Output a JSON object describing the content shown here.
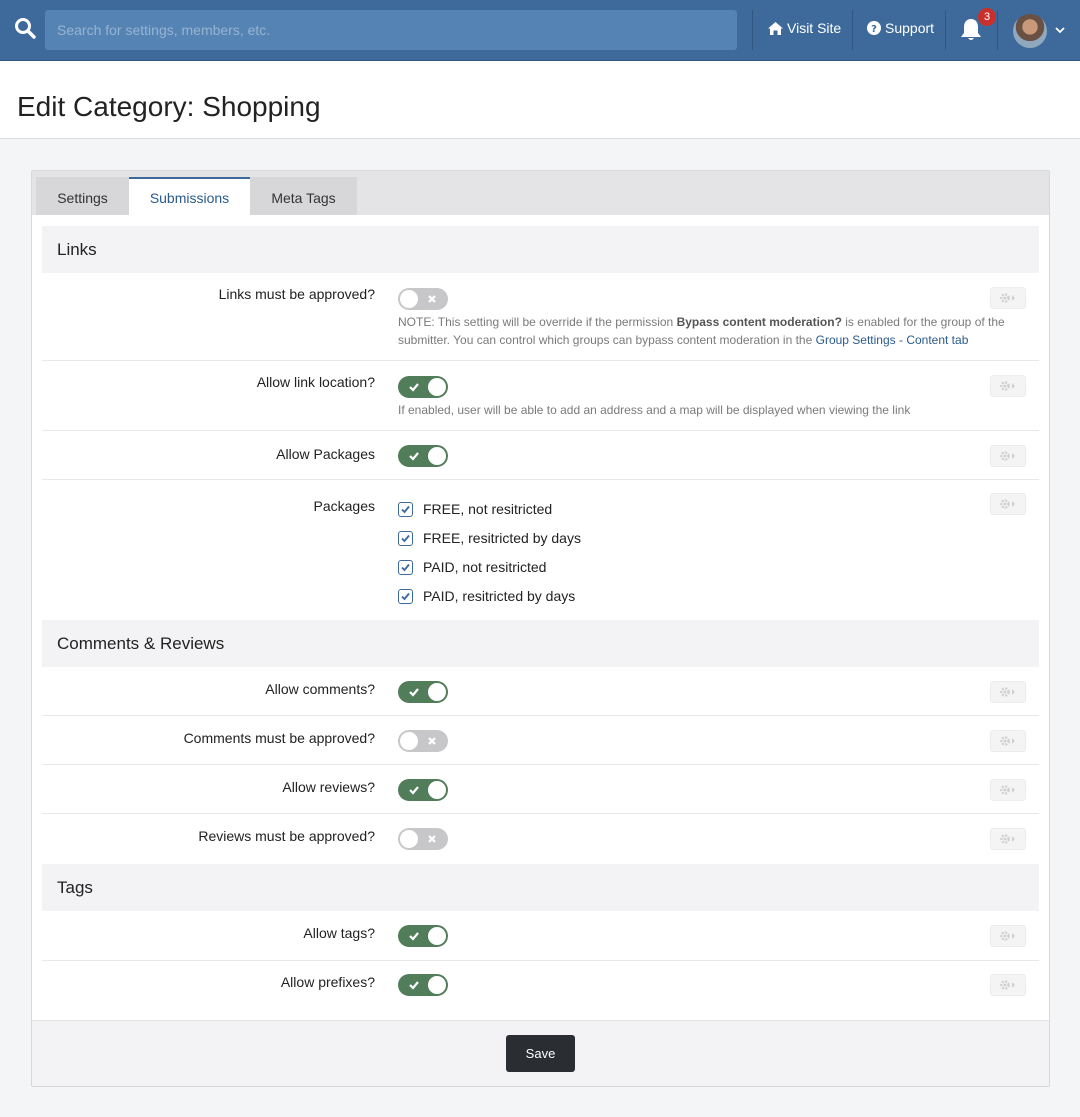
{
  "topbar": {
    "search_placeholder": "Search for settings, members, etc.",
    "visit_site": "Visit Site",
    "support": "Support",
    "notification_count": "3"
  },
  "page": {
    "title": "Edit Category: Shopping"
  },
  "tabs": [
    {
      "label": "Settings",
      "active": false
    },
    {
      "label": "Submissions",
      "active": true
    },
    {
      "label": "Meta Tags",
      "active": false
    }
  ],
  "sections": {
    "links": {
      "title": "Links",
      "links_approved": {
        "label": "Links must be approved?",
        "enabled": false,
        "help_prefix": "NOTE: This setting will be override if the permission",
        "help_bold": "Bypass content moderation?",
        "help_mid": "is enabled for the group of the submitter. You can control which groups can bypass content moderation in the",
        "help_link": "Group Settings - Content tab"
      },
      "link_location": {
        "label": "Allow link location?",
        "enabled": true,
        "help": "If enabled, user will be able to add an address and a map will be displayed when viewing the link"
      },
      "packages_toggle": {
        "label": "Allow Packages",
        "enabled": true
      },
      "packages": {
        "label": "Packages",
        "options": [
          {
            "label": "FREE, not resitricted",
            "checked": true
          },
          {
            "label": "FREE, resitricted by days",
            "checked": true
          },
          {
            "label": "PAID, not resitricted",
            "checked": true
          },
          {
            "label": "PAID, resitricted by days",
            "checked": true
          }
        ]
      }
    },
    "comments": {
      "title": "Comments & Reviews",
      "allow_comments": {
        "label": "Allow comments?",
        "enabled": true
      },
      "comments_approved": {
        "label": "Comments must be approved?",
        "enabled": false
      },
      "allow_reviews": {
        "label": "Allow reviews?",
        "enabled": true
      },
      "reviews_approved": {
        "label": "Reviews must be approved?",
        "enabled": false
      }
    },
    "tags": {
      "title": "Tags",
      "allow_tags": {
        "label": "Allow tags?",
        "enabled": true
      },
      "allow_prefixes": {
        "label": "Allow prefixes?",
        "enabled": true
      }
    }
  },
  "footer": {
    "save_label": "Save"
  },
  "colors": {
    "topbar": "#3d6a9b",
    "toggle_on": "#517d5a",
    "toggle_off": "#c7c7c9",
    "save_button": "#2a2e33",
    "accent": "#2a5b8c"
  },
  "icons": {
    "search": "search-icon",
    "home": "home-icon",
    "support": "question-circle-icon",
    "bell": "bell-icon",
    "gear": "gear-icon",
    "check": "check-icon",
    "cross": "close-icon"
  }
}
